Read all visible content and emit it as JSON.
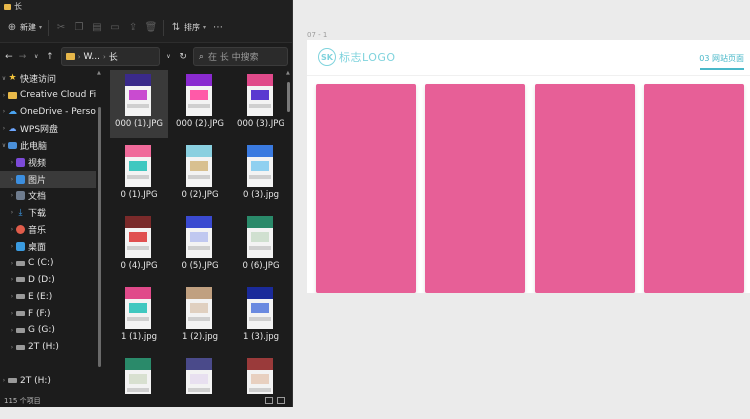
{
  "window": {
    "title": "长"
  },
  "toolbar": {
    "new_label": "新建",
    "sort_label": "排序"
  },
  "address": {
    "path_root": "W...",
    "path_sep": "›",
    "path_leaf": "长",
    "search_placeholder": "在 长 中搜索"
  },
  "sidebar": {
    "items": [
      {
        "label": "快速访问",
        "icon": "star-icon"
      },
      {
        "label": "Creative Cloud Fi",
        "icon": "folder-icon"
      },
      {
        "label": "OneDrive - Perso",
        "icon": "cloud-icon"
      },
      {
        "label": "WPS网盘",
        "icon": "wps-cloud-icon"
      },
      {
        "label": "此电脑",
        "icon": "computer-icon"
      },
      {
        "label": "视频",
        "icon": "video-folder-icon"
      },
      {
        "label": "图片",
        "icon": "pictures-folder-icon"
      },
      {
        "label": "文档",
        "icon": "documents-folder-icon"
      },
      {
        "label": "下载",
        "icon": "download-icon"
      },
      {
        "label": "音乐",
        "icon": "music-folder-icon"
      },
      {
        "label": "桌面",
        "icon": "desktop-folder-icon"
      },
      {
        "label": "C (C:)",
        "icon": "drive-icon"
      },
      {
        "label": "D (D:)",
        "icon": "drive-icon"
      },
      {
        "label": "E (E:)",
        "icon": "drive-icon"
      },
      {
        "label": "F (F:)",
        "icon": "drive-icon"
      },
      {
        "label": "G (G:)",
        "icon": "drive-icon"
      },
      {
        "label": "2T (H:)",
        "icon": "drive-icon"
      },
      {
        "label": "",
        "icon": ""
      },
      {
        "label": "2T (H:)",
        "icon": "drive-icon"
      }
    ]
  },
  "files": [
    {
      "name": "000 (1).JPG",
      "c1": "#3a2a8a",
      "c2": "#c94bd0"
    },
    {
      "name": "000 (2).JPG",
      "c1": "#8a2ad0",
      "c2": "#ff5aa8"
    },
    {
      "name": "000 (3).JPG",
      "c1": "#e04a8a",
      "c2": "#5a3ad0"
    },
    {
      "name": "0 (1).JPG",
      "c1": "#f06a9a",
      "c2": "#40c8c0"
    },
    {
      "name": "0 (2).JPG",
      "c1": "#8ad0e0",
      "c2": "#d8c090"
    },
    {
      "name": "0 (3).jpg",
      "c1": "#3a7ae0",
      "c2": "#90d0f0"
    },
    {
      "name": "0 (4).JPG",
      "c1": "#7a2a2a",
      "c2": "#e05050"
    },
    {
      "name": "0 (5).JPG",
      "c1": "#3a4ad0",
      "c2": "#c0c8f0"
    },
    {
      "name": "0 (6).JPG",
      "c1": "#2a8a6a",
      "c2": "#d0e0d0"
    },
    {
      "name": "1 (1).jpg",
      "c1": "#e04a8a",
      "c2": "#40c8c0"
    },
    {
      "name": "1 (2).jpg",
      "c1": "#c0a080",
      "c2": "#e0d0c0"
    },
    {
      "name": "1 (3).jpg",
      "c1": "#1a2a9a",
      "c2": "#6a8ae0"
    },
    {
      "name": "",
      "c1": "#2a8a6a",
      "c2": "#d8e0d0"
    },
    {
      "name": "",
      "c1": "#4a4a8a",
      "c2": "#e8e0f0"
    },
    {
      "name": "",
      "c1": "#9a3a3a",
      "c2": "#e8d0c0"
    }
  ],
  "status": {
    "item_count": "115 个项目"
  },
  "canvas": {
    "artboard_label": "07 - 1",
    "logo_text": "标志LOGO",
    "logo_mark": "SK",
    "nav_link": "03 网站页面",
    "card_color": "#e75f97",
    "accent": "#49b8c9"
  }
}
